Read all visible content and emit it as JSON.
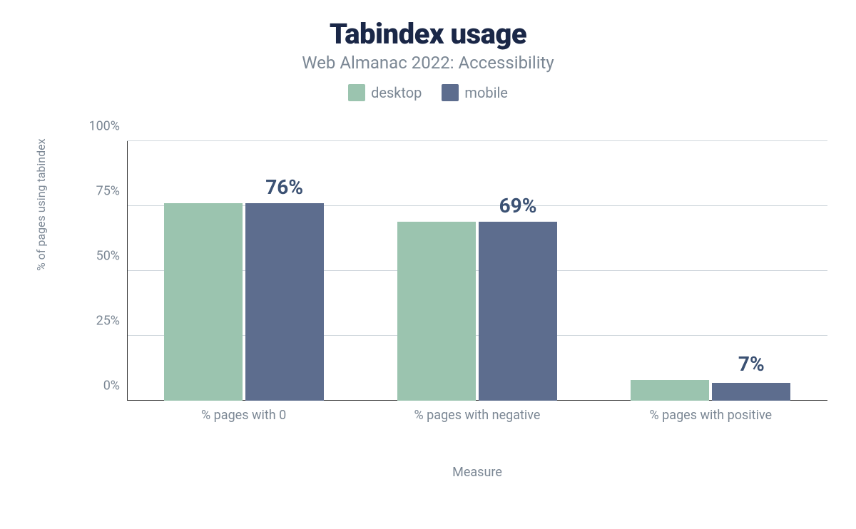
{
  "chart_data": {
    "type": "bar",
    "title": "Tabindex usage",
    "subtitle": "Web Almanac 2022: Accessibility",
    "xlabel": "Measure",
    "ylabel": "% of pages using tabindex",
    "ylim": [
      0,
      100
    ],
    "yticks": [
      0,
      25,
      50,
      75,
      100
    ],
    "categories": [
      "% pages with 0",
      "% pages with negative",
      "% pages with positive"
    ],
    "series": [
      {
        "name": "desktop",
        "color": "#9bc4af",
        "values": [
          76,
          69,
          8
        ]
      },
      {
        "name": "mobile",
        "color": "#5d6d8e",
        "values": [
          76,
          69,
          7
        ]
      }
    ],
    "data_labels_mobile": [
      "76%",
      "69%",
      "7%"
    ],
    "ytick_labels": [
      "0%",
      "25%",
      "50%",
      "75%",
      "100%"
    ]
  }
}
